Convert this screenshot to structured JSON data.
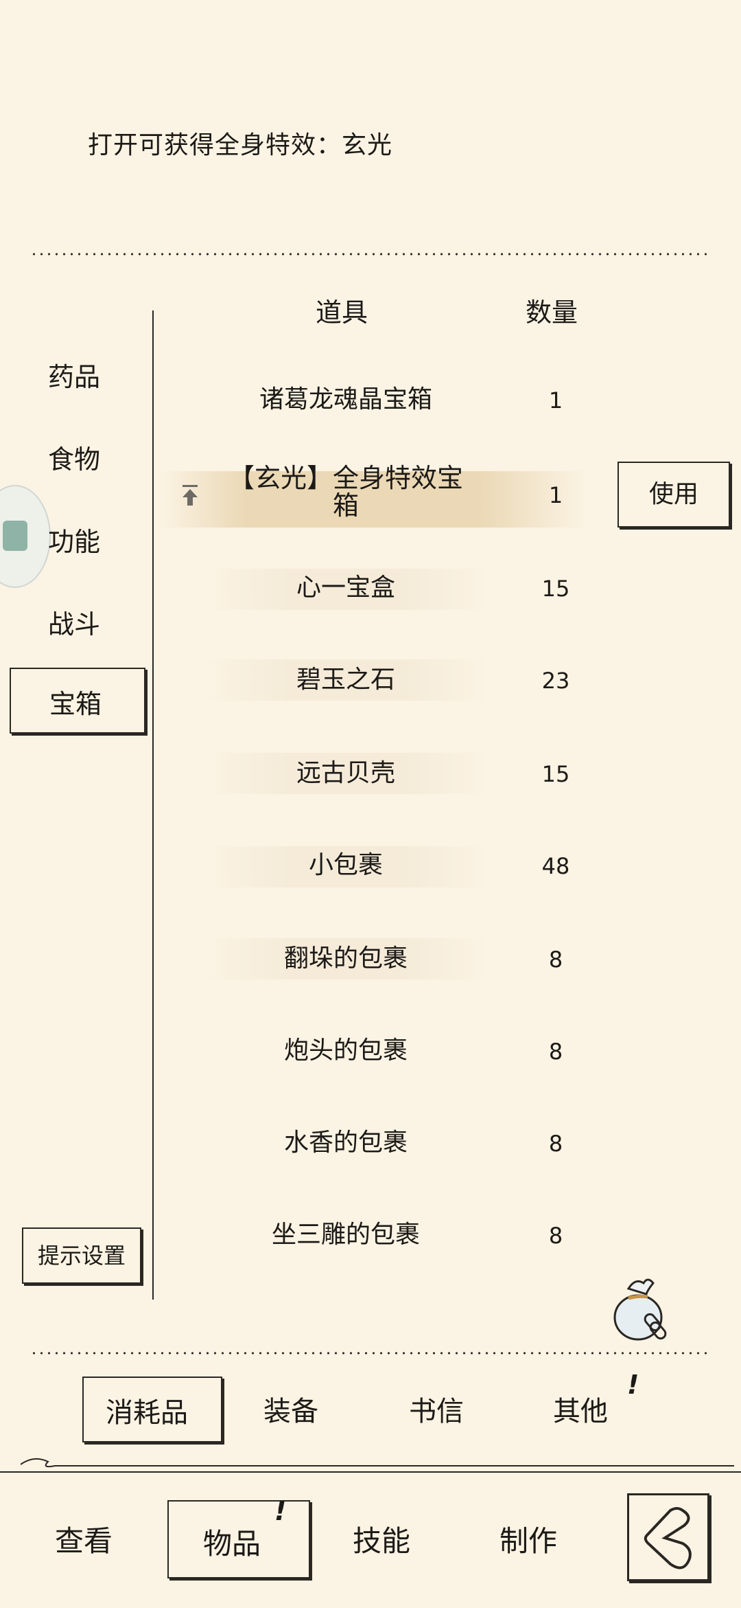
{
  "description": "打开可获得全身特效：玄光",
  "categories": [
    "药品",
    "食物",
    "功能",
    "战斗"
  ],
  "active_category": "宝箱",
  "hint_settings": "提示设置",
  "table": {
    "headers": [
      "道具",
      "数量"
    ],
    "rows": [
      {
        "name": "诸葛龙魂晶宝箱",
        "qty": "1"
      },
      {
        "name": "【玄光】全身特效宝箱",
        "qty": "1"
      },
      {
        "name": "心一宝盒",
        "qty": "15"
      },
      {
        "name": "碧玉之石",
        "qty": "23"
      },
      {
        "name": "远古贝壳",
        "qty": "15"
      },
      {
        "name": "小包裹",
        "qty": "48"
      },
      {
        "name": "翻垛的包裹",
        "qty": "8"
      },
      {
        "name": "炮头的包裹",
        "qty": "8"
      },
      {
        "name": "水香的包裹",
        "qty": "8"
      },
      {
        "name": "坐三雕的包裹",
        "qty": "8"
      }
    ],
    "selected_row_1": "【玄光】全身特效宝",
    "selected_row_2": "箱"
  },
  "use_button": "使用",
  "tabs": {
    "active": "消耗品",
    "others": [
      "装备",
      "书信",
      "其他"
    ]
  },
  "nav": {
    "items": [
      "查看",
      "技能",
      "制作"
    ],
    "active": "物品"
  },
  "icons": {
    "pin": "pin-to-top-icon",
    "bag": "bag-icon",
    "back": "back-icon",
    "badge": "side-badge-icon"
  },
  "colors": {
    "background": "#fbf3e3",
    "ink": "#2a2723",
    "selected": "#e8d4ae"
  }
}
